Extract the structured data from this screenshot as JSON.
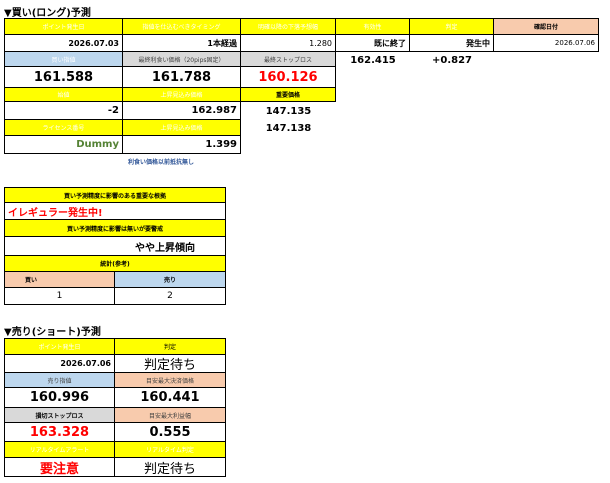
{
  "long": {
    "title": "▼買い(ロング)予測",
    "row1_headers": [
      "ポイント発生日",
      "指値を仕込むべきタイミング",
      "明確以降の下落予想幅",
      "有効性",
      "判定",
      "確認日付"
    ],
    "row1_values": [
      "2026.07.03",
      "1本経過",
      "1.280",
      "既に終了",
      "発生中",
      "2026.07.06"
    ],
    "row2_headers": [
      "買い指値",
      "最終利食い価格（20pips固定）",
      "最終ストップロス"
    ],
    "row2_values": [
      "161.588",
      "161.788",
      "160.126"
    ],
    "row2_right": [
      "162.415",
      "+0.827"
    ],
    "row3_headers": [
      "始値",
      "上昇見込み価格",
      "重要価格"
    ],
    "row3_values": [
      "-2",
      "162.987",
      "147.135"
    ],
    "row3_extra": "147.138",
    "row4_headers": [
      "ライセンス番号",
      "上昇見込み価格"
    ],
    "row4_values": [
      "Dummy",
      "1.399"
    ],
    "link": "利食い価格以前抵抗無し"
  },
  "mid": {
    "header1": "買い予測精度に影響のある重要な根拠",
    "value1": "イレギュラー発生中!",
    "header2": "買い予測精度に影響は無いが要警戒",
    "value2": "やや上昇傾向",
    "header3": "統計(参考)",
    "buy_label": "買い",
    "sell_label": "売り",
    "buy_count": "1",
    "sell_count": "2"
  },
  "short": {
    "title": "▼売り(ショート)予測",
    "h1": [
      "ポイント発生日",
      "判定"
    ],
    "v1": [
      "2026.07.06",
      "判定待ち"
    ],
    "h2": [
      "売り指値",
      "目安最大決済価格"
    ],
    "v2": [
      "160.996",
      "160.441"
    ],
    "h3": [
      "損切ストップロス",
      "目安最大利益幅"
    ],
    "v3": [
      "163.328",
      "0.555"
    ],
    "h4": [
      "リアルタイムアラート",
      "リアルタイム判定"
    ],
    "v4": [
      "要注意",
      "判定待ち"
    ]
  }
}
